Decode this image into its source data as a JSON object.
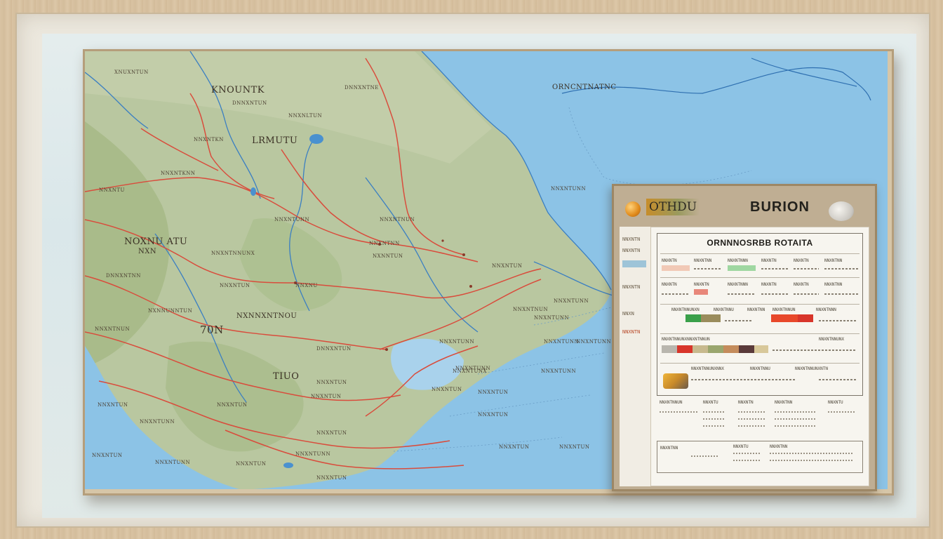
{
  "map": {
    "labels": [
      {
        "text": "XNUXNTUN",
        "size": "lbl-xs"
      },
      {
        "text": "KNOUNTK",
        "size": "lbl-md"
      },
      {
        "text": "DNNXNTUN",
        "size": "lbl-xs"
      },
      {
        "text": "DNNXNTNE",
        "size": "lbl-xs"
      },
      {
        "text": "NNXNLTUN",
        "size": "lbl-xs"
      },
      {
        "text": "NNXNTKN",
        "size": "lbl-xs"
      },
      {
        "text": "LRMUTU",
        "size": "lbl-md"
      },
      {
        "text": "NNXNTKNN",
        "size": "lbl-xs"
      },
      {
        "text": "NNXNTU",
        "size": "lbl-xs"
      },
      {
        "text": "NOXNU ATU",
        "size": "lbl-md"
      },
      {
        "text": "NXN",
        "size": "lbl-sm"
      },
      {
        "text": "NNXNTNNUNX",
        "size": "lbl-xs"
      },
      {
        "text": "NNXNTUNN",
        "size": "lbl-xs"
      },
      {
        "text": "NNXNTNUN",
        "size": "lbl-xs"
      },
      {
        "text": "NNXNTNN",
        "size": "lbl-xs"
      },
      {
        "text": "NXNNTUN",
        "size": "lbl-xs"
      },
      {
        "text": "NNXNTUN",
        "size": "lbl-xs"
      },
      {
        "text": "DNNXNTNN",
        "size": "lbl-xs"
      },
      {
        "text": "NNXNTUN",
        "size": "lbl-xs"
      },
      {
        "text": "NNXNU",
        "size": "lbl-xs"
      },
      {
        "text": "NXNNUNNTUN",
        "size": "lbl-xs"
      },
      {
        "text": "NNXNTNUN",
        "size": "lbl-xs"
      },
      {
        "text": "DNNXNTUN",
        "size": "lbl-xs"
      },
      {
        "text": "NNXNTUNN",
        "size": "lbl-xs"
      },
      {
        "text": "70N",
        "size": "lbl-lg"
      },
      {
        "text": "NXNNXNTNOU",
        "size": "lbl-sm"
      },
      {
        "text": "NNXNTUNX",
        "size": "lbl-xs"
      },
      {
        "text": "NNXNTUN",
        "size": "lbl-xs"
      },
      {
        "text": "TIUO",
        "size": "lbl-md"
      },
      {
        "text": "NNXNTUN",
        "size": "lbl-xs"
      },
      {
        "text": "NNXNTUN",
        "size": "lbl-xs"
      },
      {
        "text": "NNXNTUN",
        "size": "lbl-xs"
      },
      {
        "text": "NNXNTUNN",
        "size": "lbl-xs"
      },
      {
        "text": "NNXNTUN",
        "size": "lbl-xs"
      },
      {
        "text": "NNXNTUN",
        "size": "lbl-xs"
      },
      {
        "text": "NNXNTUNN",
        "size": "lbl-xs"
      },
      {
        "text": "NNXNTUNN",
        "size": "lbl-xs"
      },
      {
        "text": "NNXNTUN",
        "size": "lbl-xs"
      },
      {
        "text": "NNXNTUN",
        "size": "lbl-xs"
      },
      {
        "text": "ORNCNTNATNC",
        "size": "lbl-sm"
      },
      {
        "text": "NNXNTUNN",
        "size": "lbl-xs"
      },
      {
        "text": "NNXNTNUN",
        "size": "lbl-xs"
      },
      {
        "text": "NNXNTUNN",
        "size": "lbl-xs"
      },
      {
        "text": "NNXNTUNN",
        "size": "lbl-xs"
      },
      {
        "text": "NNXNTUNN",
        "size": "lbl-xs"
      },
      {
        "text": "NNXNTUNN",
        "size": "lbl-xs"
      },
      {
        "text": "NNXNTUNN",
        "size": "lbl-xs"
      },
      {
        "text": "NNXNTUNN",
        "size": "lbl-xs"
      },
      {
        "text": "NNXNTUN",
        "size": "lbl-xs"
      },
      {
        "text": "NNXNTUN",
        "size": "lbl-xs"
      },
      {
        "text": "NNXNTUN",
        "size": "lbl-xs"
      },
      {
        "text": "NNXNTUN",
        "size": "lbl-xs"
      },
      {
        "text": "NNXNTUN",
        "size": "lbl-xs"
      }
    ],
    "colors": {
      "land": "#b9c7a0",
      "land_dark": "#9fb57e",
      "water": "#8cc3e6",
      "road": "#d94c3c",
      "river": "#3b7fc2"
    }
  },
  "panel": {
    "tag": "OTHDU",
    "title": "BURION",
    "side_labels": [
      "NNXNTN",
      "NNXNTN",
      "NNXNTN",
      "NNXN",
      "NNXNTN"
    ],
    "sheet_title": "ORNNNOSRBB ROTAITA",
    "rows": [
      {
        "cells": [
          "NNXNTN",
          "NNXNTNN",
          "NNXNTNNN",
          "NNXNTN",
          "NNXNTN",
          "NNXNTNN"
        ]
      },
      {
        "cells": [
          "NNXNTN",
          "NNXNTN",
          "NNXNTNNN",
          "NNXNTN",
          "NNXNTN",
          "NNXNTNN"
        ]
      },
      {
        "cells": [
          "NNXNTNNUNXN",
          "NNXNTNNU",
          "NNXNTNN",
          "NNXNTNNUN",
          "NNXNTNNN"
        ]
      },
      {
        "cells": [
          "NNXNTNNUNXNNXNTNNUN",
          "NNXNTNNUNX"
        ]
      },
      {
        "cells": [
          "NNXNTNNUNXNNX",
          "NNXNTNNU",
          "NNXNTNNUNXNTN"
        ]
      }
    ],
    "bottom_labels": [
      "NNXNTNNUN",
      "NNXNTU",
      "NNXNTN",
      "NNXNTNN",
      "NNXNTU",
      "NNXNTNN",
      "NNXNTU",
      "NNXNTNN"
    ]
  }
}
